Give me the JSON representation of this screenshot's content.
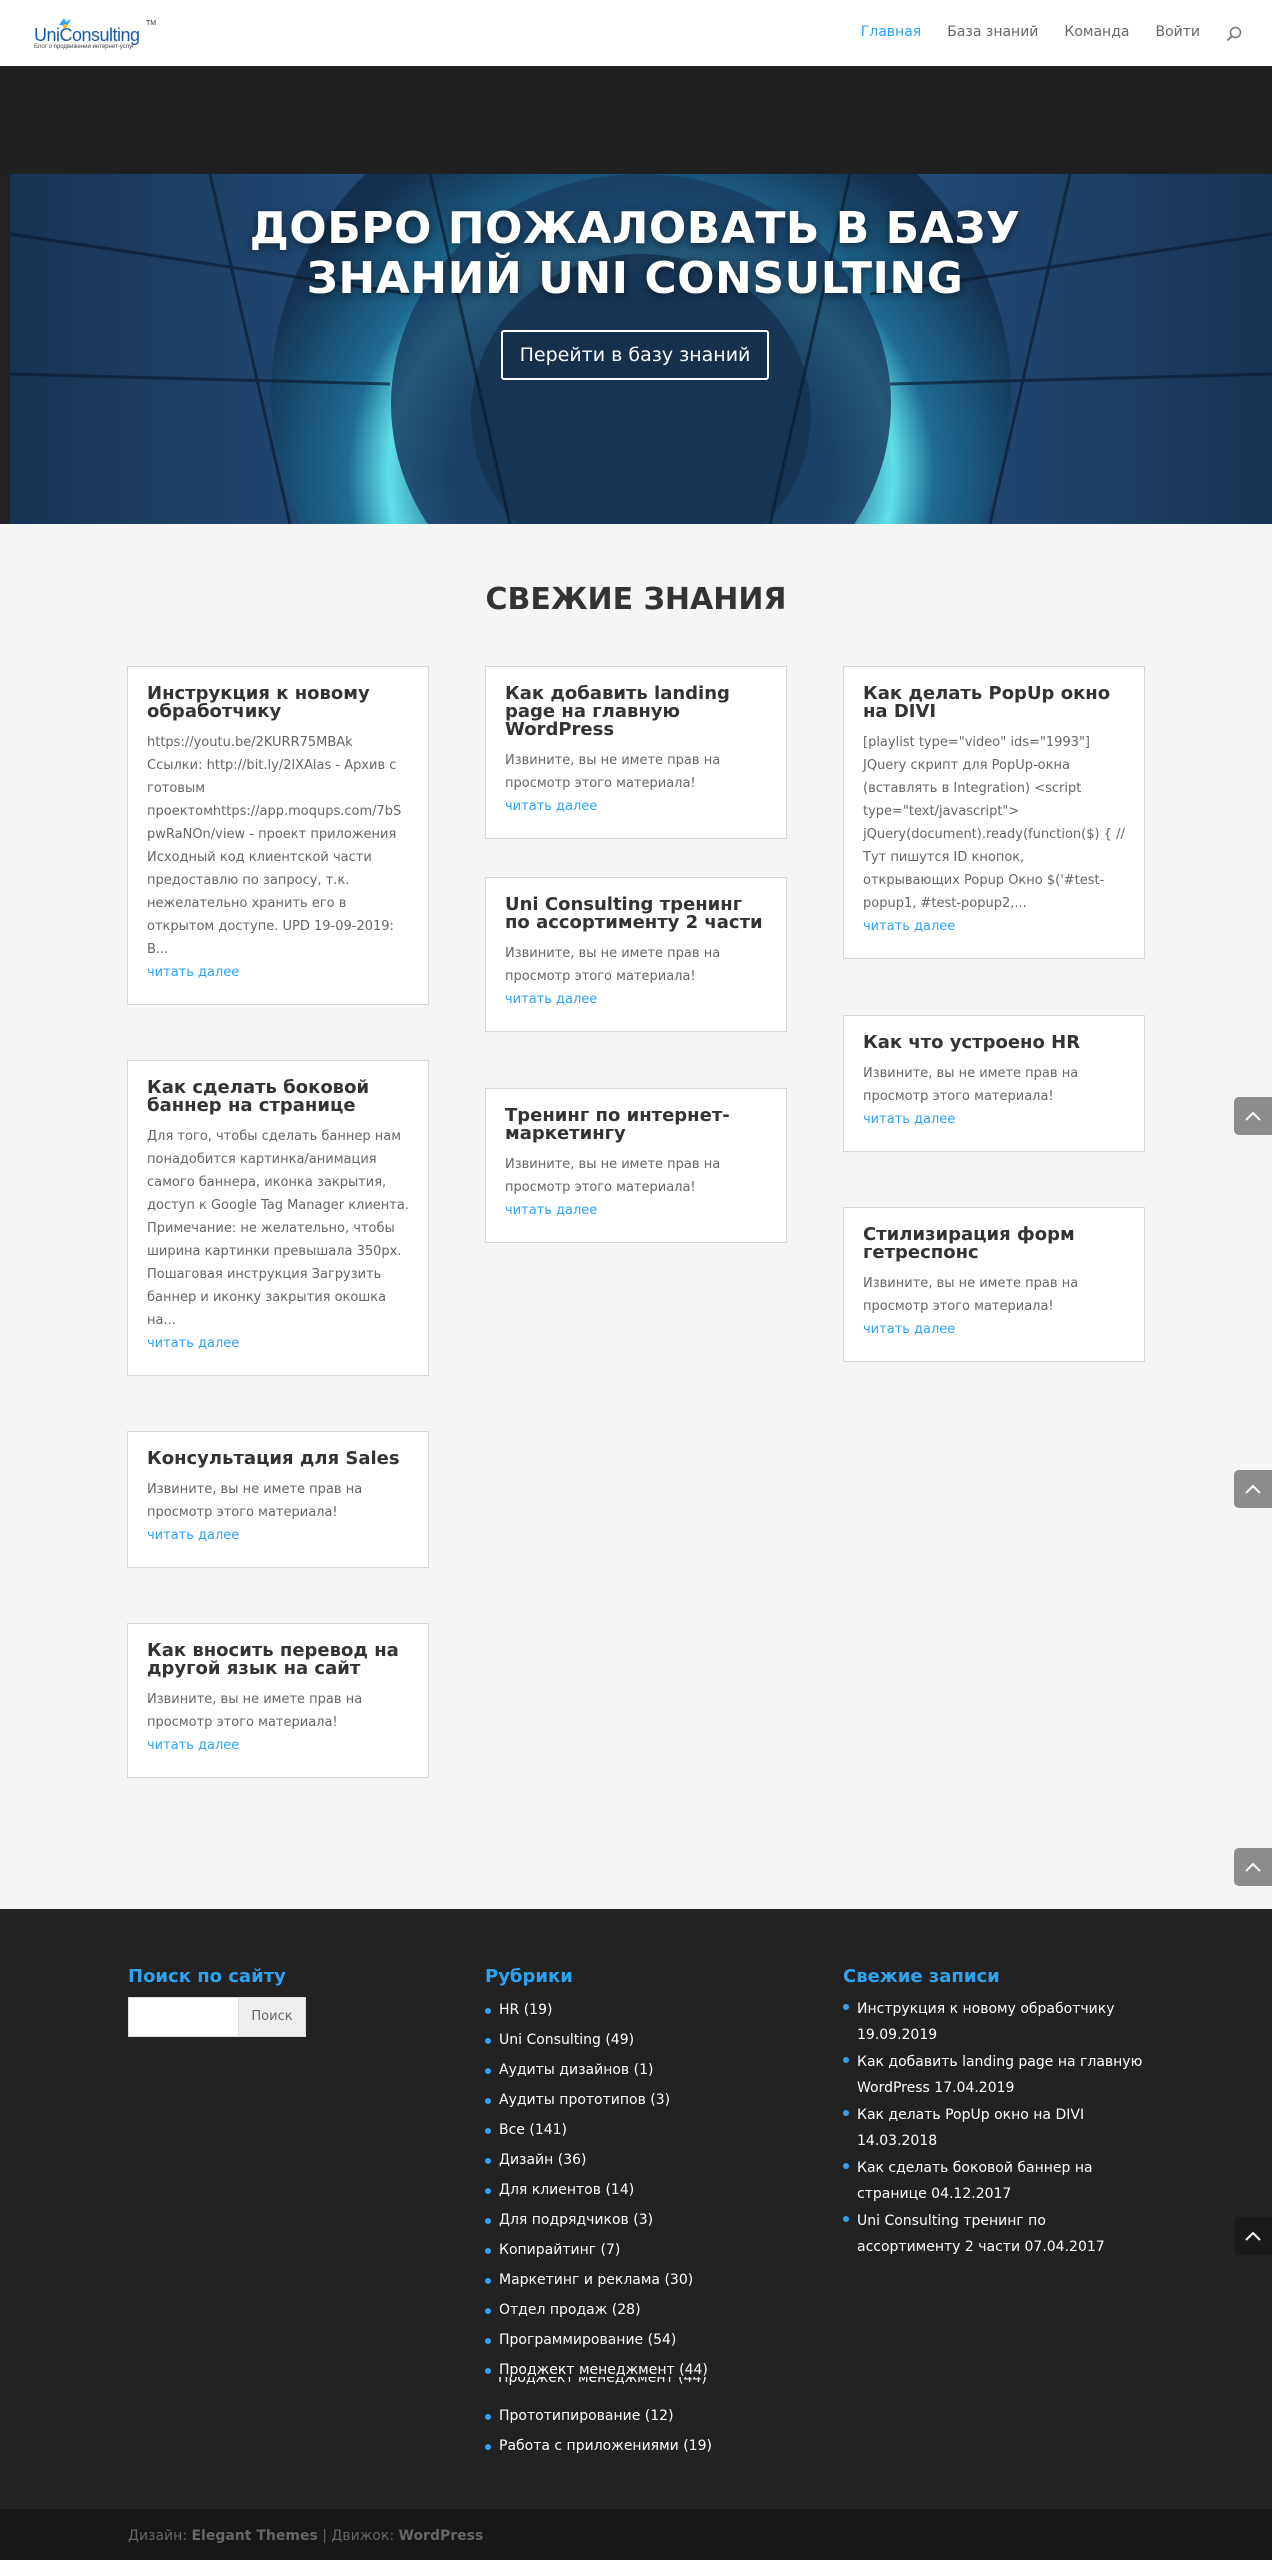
{
  "header": {
    "logo": {
      "uni": "Uni",
      "consulting": "Consulting",
      "tm": "TM",
      "tagline": "Блог о продвижении интернет-услуг"
    },
    "nav": [
      {
        "label": "Главная",
        "active": true
      },
      {
        "label": "База знаний",
        "active": false
      },
      {
        "label": "Команда",
        "active": false
      },
      {
        "label": "Войти",
        "active": false
      }
    ],
    "search_icon": "search-icon"
  },
  "hero": {
    "title_line1": "ДОБРО ПОЖАЛОВАТЬ В БАЗУ",
    "title_line2": "ЗНАНИЙ UNI CONSULTING",
    "button": "Перейти в базу знаний"
  },
  "main": {
    "section_title": "СВЕЖИЕ ЗНАНИЯ",
    "read_more": "читать далее",
    "cards": [
      {
        "title": "Инструкция к новому обработчику",
        "text": "https://youtu.be/2KURR75MBAk Ссылки: http://bit.ly/2lXAlas - Архив с готовым проектомhttps://app.moqups.com/7bSpwRaNOn/view - проект приложения Исходный код клиентской части предоставлю по запросу, т.к. нежелательно хранить его в открытом доступе. UPD 19-09-2019: В..."
      },
      {
        "title": "Как сделать боковой баннер на странице",
        "text": "Для того, чтобы сделать баннер нам понадобится картинка/анимация самого баннера, иконка закрытия, доступ к Google Tag Manager клиента. Примечание: не желательно, чтобы ширина картинки превышала 350px. Пошаговая инструкция Загрузить баннер и иконку закрытия окошка на..."
      },
      {
        "title": "Консультация для Sales",
        "text": "Извините, вы не имете прав на просмотр этого материала!"
      },
      {
        "title": "Как вносить перевод на другой язык на сайт",
        "text": "Извините, вы не имете прав на просмотр этого материала!"
      },
      {
        "title": "Как добавить landing page на главную WordPress",
        "text": "Извините, вы не имете прав на просмотр этого материала!"
      },
      {
        "title": "Uni Consulting тренинг по ассортименту 2 части",
        "text": "Извините, вы не имете прав на просмотр этого материала!"
      },
      {
        "title": "Тренинг по интернет-маркетингу",
        "text": "Извините, вы не имете прав на просмотр этого материала!"
      },
      {
        "title": "Как делать PopUp окно на DIVI",
        "text": "[playlist type=\"video\" ids=\"1993\"] JQuery скрипт для PopUp-окна (вставлять в Integration) <script type=\"text/javascript\"> jQuery(document).ready(function($) { // Тут пишутся ID кнопок, открывающих Popup Окно $('#test-popup1, #test-popup2,..."
      },
      {
        "title": "Как что устроено HR",
        "text": "Извините, вы не имете прав на просмотр этого материала!"
      },
      {
        "title": "Стилизирация форм гетреспонс",
        "text": "Извините, вы не имете прав на просмотр этого материала!"
      }
    ]
  },
  "footer": {
    "search": {
      "title": "Поиск по сайту",
      "placeholder": "",
      "button": "Поиск"
    },
    "rubrics": {
      "title": "Рубрики",
      "items": [
        "HR (19)",
        "Uni Consulting (49)",
        "Аудиты дизайнов (1)",
        "Аудиты прототипов (3)",
        "Все (141)",
        "Дизайн (36)",
        "Для клиентов (14)",
        "Для подрядчиков (3)",
        "Копирайтинг (7)",
        "Маркетинг и реклама (30)",
        "Отдел продаж (28)",
        "Программирование (54)",
        "Проджект менеджмент (44)",
        "Прототипирование (12)",
        "Работа с приложениями (19)"
      ],
      "ghost": "Проджект менеджмент (44)"
    },
    "recent": {
      "title": "Свежие записи",
      "items": [
        "Инструкция к новому обработчику 19.09.2019",
        "Как добавить landing page на главную WordPress 17.04.2019",
        "Как делать PopUp окно на DIVI 14.03.2018",
        "Как сделать боковой баннер на странице 04.12.2017",
        "Uni Consulting тренинг по ассортименту 2 части 07.04.2017"
      ]
    },
    "credits": {
      "design_label": "Дизайн:",
      "design_name": "Elegant Themes",
      "separator": "|",
      "engine_label": "Движок:",
      "engine_name": "WordPress"
    }
  },
  "colors": {
    "accent": "#2ea3f2",
    "footer_bg": "#222222",
    "main_bg": "#f5f5f5",
    "hero_glow": "#5fe0e8"
  },
  "icons": {
    "scroll_top": "chevron-up-icon"
  }
}
